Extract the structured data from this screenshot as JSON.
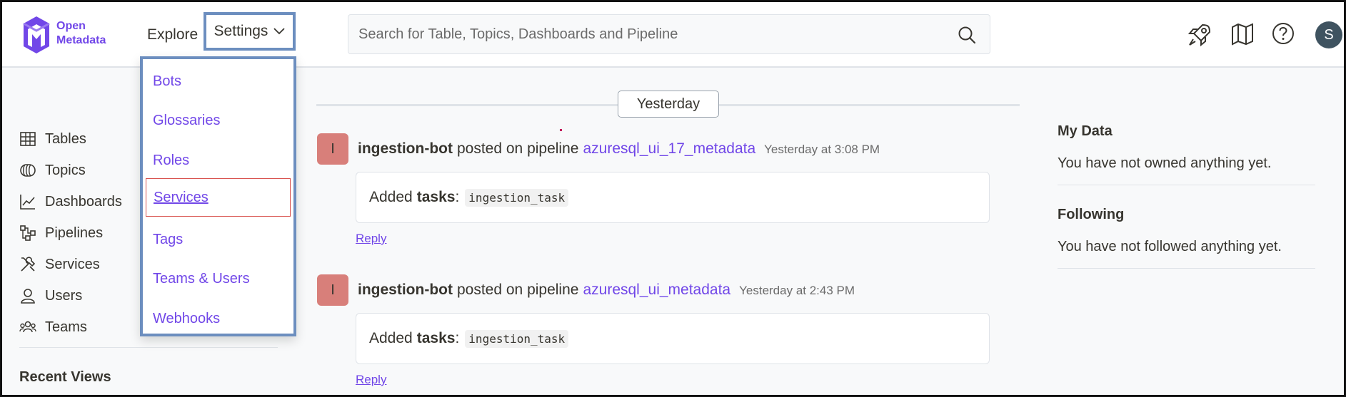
{
  "brand": {
    "line1": "Open",
    "line2": "Metadata"
  },
  "nav": {
    "explore": "Explore",
    "settings": "Settings"
  },
  "search": {
    "placeholder": "Search for Table, Topics, Dashboards and Pipeline"
  },
  "user": {
    "initial": "S"
  },
  "settings_menu": {
    "items": [
      "Bots",
      "Glossaries",
      "Roles",
      "Services",
      "Tags",
      "Teams & Users",
      "Webhooks"
    ],
    "active": "Services"
  },
  "sidebar": {
    "items": [
      {
        "label": "Tables",
        "icon": "table-icon"
      },
      {
        "label": "Topics",
        "icon": "topics-icon"
      },
      {
        "label": "Dashboards",
        "icon": "dashboard-chart-icon"
      },
      {
        "label": "Pipelines",
        "icon": "pipeline-icon"
      },
      {
        "label": "Services",
        "icon": "tools-icon"
      },
      {
        "label": "Users",
        "icon": "user-icon"
      },
      {
        "label": "Teams",
        "icon": "teams-icon"
      }
    ],
    "recent_views": "Recent Views"
  },
  "feed": {
    "date_label": "Yesterday",
    "posts": [
      {
        "avatar": "I",
        "user": "ingestion-bot",
        "action": "posted on pipeline",
        "entity": "azuresql_ui_17_metadata",
        "time": "Yesterday at 3:08 PM",
        "body_prefix": "Added",
        "body_field": "tasks",
        "body_sep": ":",
        "body_code": "ingestion_task",
        "reply": "Reply"
      },
      {
        "avatar": "I",
        "user": "ingestion-bot",
        "action": "posted on pipeline",
        "entity": "azuresql_ui_metadata",
        "time": "Yesterday at 2:43 PM",
        "body_prefix": "Added",
        "body_field": "tasks",
        "body_sep": ":",
        "body_code": "ingestion_task",
        "reply": "Reply"
      }
    ]
  },
  "right_panel": {
    "my_data_title": "My Data",
    "my_data_text": "You have not owned anything yet.",
    "following_title": "Following",
    "following_text": "You have not followed anything yet."
  },
  "colors": {
    "brand": "#7147e8",
    "highlight_border": "#6c8ebf",
    "active_border": "#d9534f",
    "avatar_bg": "#d87f7a"
  }
}
